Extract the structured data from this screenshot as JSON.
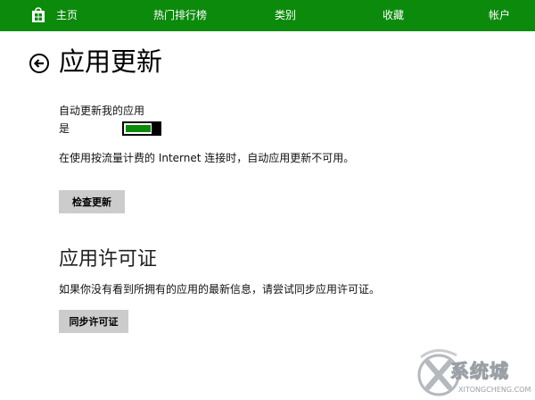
{
  "nav": {
    "home": "主页",
    "top_charts": "热门排行榜",
    "categories": "类别",
    "favorites": "收藏",
    "account": "帐户"
  },
  "page": {
    "title": "应用更新"
  },
  "auto_update": {
    "label": "自动更新我的应用",
    "state": "是",
    "note": "在使用按流量计费的 Internet 连接时，自动应用更新不可用。",
    "check_button": "检查更新"
  },
  "license": {
    "title": "应用许可证",
    "note": "如果你没有看到所拥有的应用的最新信息，请尝试同步应用许可证。",
    "sync_button": "同步许可证"
  },
  "watermark": {
    "text": "系统城",
    "sub": "XITONGCHENG.COM"
  },
  "colors": {
    "accent": "#0b8a0b"
  }
}
